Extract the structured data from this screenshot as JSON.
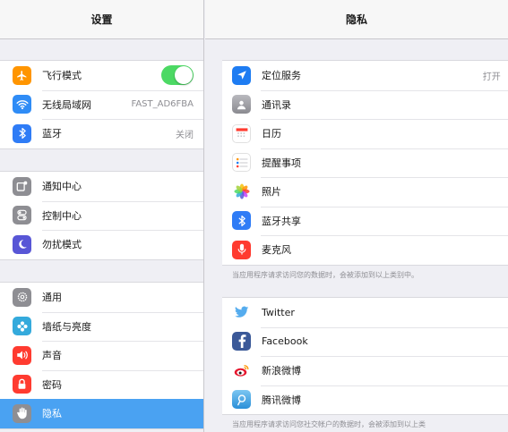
{
  "left": {
    "title": "设置",
    "groups": [
      [
        {
          "label": "飞行模式",
          "icon": "airplane-icon",
          "toggle_on": true
        },
        {
          "label": "无线局域网",
          "icon": "wifi-icon",
          "value": "FAST_AD6FBA"
        },
        {
          "label": "蓝牙",
          "icon": "bluetooth-icon",
          "value": "关闭"
        }
      ],
      [
        {
          "label": "通知中心",
          "icon": "notification-center-icon"
        },
        {
          "label": "控制中心",
          "icon": "control-center-icon"
        },
        {
          "label": "勿扰模式",
          "icon": "moon-icon"
        }
      ],
      [
        {
          "label": "通用",
          "icon": "gear-icon"
        },
        {
          "label": "墙纸与亮度",
          "icon": "wallpaper-icon"
        },
        {
          "label": "声音",
          "icon": "speaker-icon"
        },
        {
          "label": "密码",
          "icon": "lock-icon"
        },
        {
          "label": "隐私",
          "icon": "hand-icon",
          "selected": true
        }
      ]
    ]
  },
  "right": {
    "title": "隐私",
    "groups": [
      [
        {
          "label": "定位服务",
          "icon": "location-arrow-icon",
          "value": "打开"
        },
        {
          "label": "通讯录",
          "icon": "contacts-icon"
        },
        {
          "label": "日历",
          "icon": "calendar-icon"
        },
        {
          "label": "提醒事项",
          "icon": "reminders-icon"
        },
        {
          "label": "照片",
          "icon": "photos-icon"
        },
        {
          "label": "蓝牙共享",
          "icon": "bluetooth-icon"
        },
        {
          "label": "麦克风",
          "icon": "microphone-icon"
        }
      ],
      [
        {
          "label": "Twitter",
          "icon": "twitter-icon"
        },
        {
          "label": "Facebook",
          "icon": "facebook-icon"
        },
        {
          "label": "新浪微博",
          "icon": "sina-weibo-icon"
        },
        {
          "label": "腾讯微博",
          "icon": "tencent-weibo-icon"
        }
      ]
    ],
    "footer_1": "当应用程序请求访问您的数据时，会被添加到以上类别中。",
    "footer_2": "当应用程序请求访问您社交帐户的数据时，会被添加到以上类"
  },
  "colors": {
    "selected_row": "#4aa2f2",
    "toggle_on": "#4cd964",
    "airplane": "#ff9500",
    "wifi": "#2f8cf6",
    "bluetooth": "#2f7cf6",
    "notification": "#8e8e93",
    "control": "#8e8e93",
    "do_not_disturb": "#5856d6",
    "general": "#8e8e93",
    "wallpaper": "#34aadc",
    "sound": "#ff3b30",
    "passcode": "#ff3b30",
    "privacy": "#8e8e93",
    "location": "#1e7cf2",
    "microphone": "#ff3b30",
    "twitter": "#55acee",
    "facebook": "#3b5998"
  }
}
